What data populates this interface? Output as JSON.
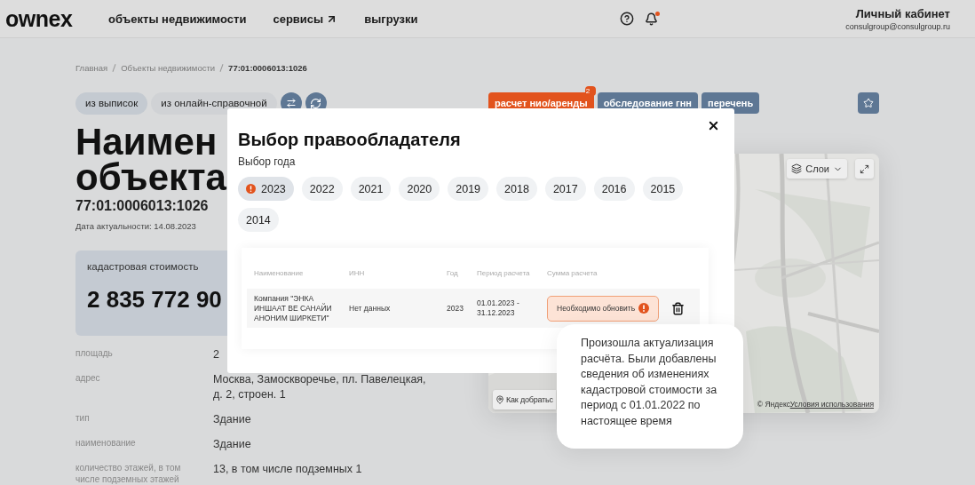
{
  "header": {
    "logo": "ownex",
    "nav": [
      {
        "label": "объекты недвижимости",
        "external": false
      },
      {
        "label": "сервисы",
        "external": true
      },
      {
        "label": "выгрузки",
        "external": false
      }
    ],
    "notifications_unread": true,
    "account": {
      "title": "Личный кабинет",
      "email": "consulgroup@consulgroup.ru"
    }
  },
  "breadcrumbs": [
    "Главная",
    "Объекты недвижимости",
    "77:01:0006013:1026"
  ],
  "source_tabs": [
    {
      "label": "из выписок",
      "selected": true
    },
    {
      "label": "из онлайн-справочной",
      "selected": false
    }
  ],
  "actions": [
    {
      "label": "расчет нио/аренды",
      "kind": "primary",
      "badge": "2"
    },
    {
      "label": "обследование гнн",
      "kind": "secondary"
    },
    {
      "label": "перечень",
      "kind": "secondary"
    }
  ],
  "object": {
    "title_lines": [
      "Наимен",
      "объекта"
    ],
    "cadastral_number": "77:01:0006013:1026",
    "date": "Дата актуальности: 14.08.2023",
    "cost_label": "кадастровая стоимость",
    "cost_value": "2 835 772 90",
    "properties": [
      {
        "label": "площадь",
        "value": "2"
      },
      {
        "label": "адрес",
        "value": "Москва, Замоскворечье, пл. Павелецкая, д. 2, строен. 1"
      },
      {
        "label": "тип",
        "value": "Здание"
      },
      {
        "label": "наименование",
        "value": "Здание"
      },
      {
        "label": "количество этажей, в том числе подземных этажей",
        "value": "13, в том числе подземных 1"
      }
    ]
  },
  "map": {
    "layers_button": "Слои",
    "route_button": "Как добратьс",
    "attribution": "© Яндекс",
    "terms_link": "Условия использования"
  },
  "modal": {
    "title": "Выбор правообладателя",
    "subtitle": "Выбор года",
    "years": [
      {
        "label": "2023",
        "selected": true,
        "alert": true
      },
      {
        "label": "2022",
        "selected": false,
        "alert": false
      },
      {
        "label": "2021",
        "selected": false,
        "alert": false
      },
      {
        "label": "2020",
        "selected": false,
        "alert": false
      },
      {
        "label": "2019",
        "selected": false,
        "alert": false
      },
      {
        "label": "2018",
        "selected": false,
        "alert": false
      },
      {
        "label": "2017",
        "selected": false,
        "alert": false
      },
      {
        "label": "2016",
        "selected": false,
        "alert": false
      },
      {
        "label": "2015",
        "selected": false,
        "alert": false
      },
      {
        "label": "2014",
        "selected": false,
        "alert": false
      }
    ],
    "table": {
      "columns": [
        "Наименование",
        "ИНН",
        "Год",
        "Период расчета",
        "Сумма расчета"
      ],
      "rows": [
        {
          "name": "Компания \"ЭНКА ИНШААТ ВЕ САНАЙИ АНОНИМ ШИРКЕТИ\"",
          "inn": "Нет данных",
          "year": "2023",
          "period": "01.01.2023 - 31.12.2023",
          "status": "Необходимо обновить",
          "alert": true
        }
      ]
    },
    "tooltip": "Произошла актуализация расчёта. Были добавлены сведения об изменениях кадастровой стоимости за период с 01.01.2022 по настоящее время"
  }
}
